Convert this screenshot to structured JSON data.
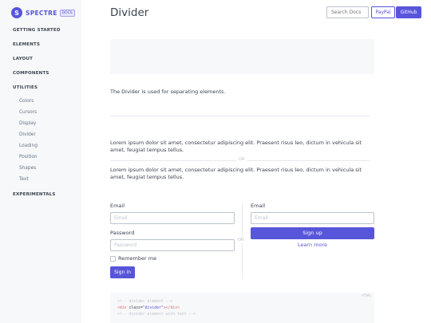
{
  "sidebar": {
    "brand": {
      "logo": "S",
      "name": "SPECTRE",
      "label": "DOCS"
    },
    "sections": [
      {
        "label": "GETTING STARTED"
      },
      {
        "label": "ELEMENTS"
      },
      {
        "label": "LAYOUT"
      },
      {
        "label": "COMPONENTS"
      },
      {
        "label": "UTILITIES"
      },
      {
        "label": "EXPERIMENTALS"
      }
    ],
    "utilities_items": [
      "Colors",
      "Cursors",
      "Display",
      "Divider",
      "Loading",
      "Position",
      "Shapes",
      "Text"
    ]
  },
  "header": {
    "title": "Divider",
    "search_placeholder": "Search Docs",
    "paypal_label": "PayPal",
    "github_label": "GitHub"
  },
  "content": {
    "intro": "The Divider is used for separating elements.",
    "lorem": "Lorem ipsum dolor sit amet, consectetur adipiscing elit. Praesent risus leo, dictum in vehicula sit amet, feugiat tempus tellus.",
    "or_label": "OR",
    "form_left": {
      "email_label": "Email",
      "email_placeholder": "Email",
      "password_label": "Password",
      "password_placeholder": "Password",
      "remember_label": "Remember me",
      "signin_label": "Sign in"
    },
    "form_right": {
      "email_label": "Email",
      "email_placeholder": "Email",
      "signup_label": "Sign up",
      "learn_more_label": "Learn more"
    },
    "code": {
      "lang": "HTML",
      "line1": "<!-- divider element -->",
      "line2_tag_open": "<div ",
      "line2_attr": "class=",
      "line2_val": "\"divider\"",
      "line2_tag_close": "></div>",
      "line3": "<!-- divider element with text -->"
    }
  },
  "colors": {
    "primary": "#5755d9",
    "sidebar_bg": "#f7f8f9",
    "text": "#3b4351",
    "muted": "#66758c"
  }
}
